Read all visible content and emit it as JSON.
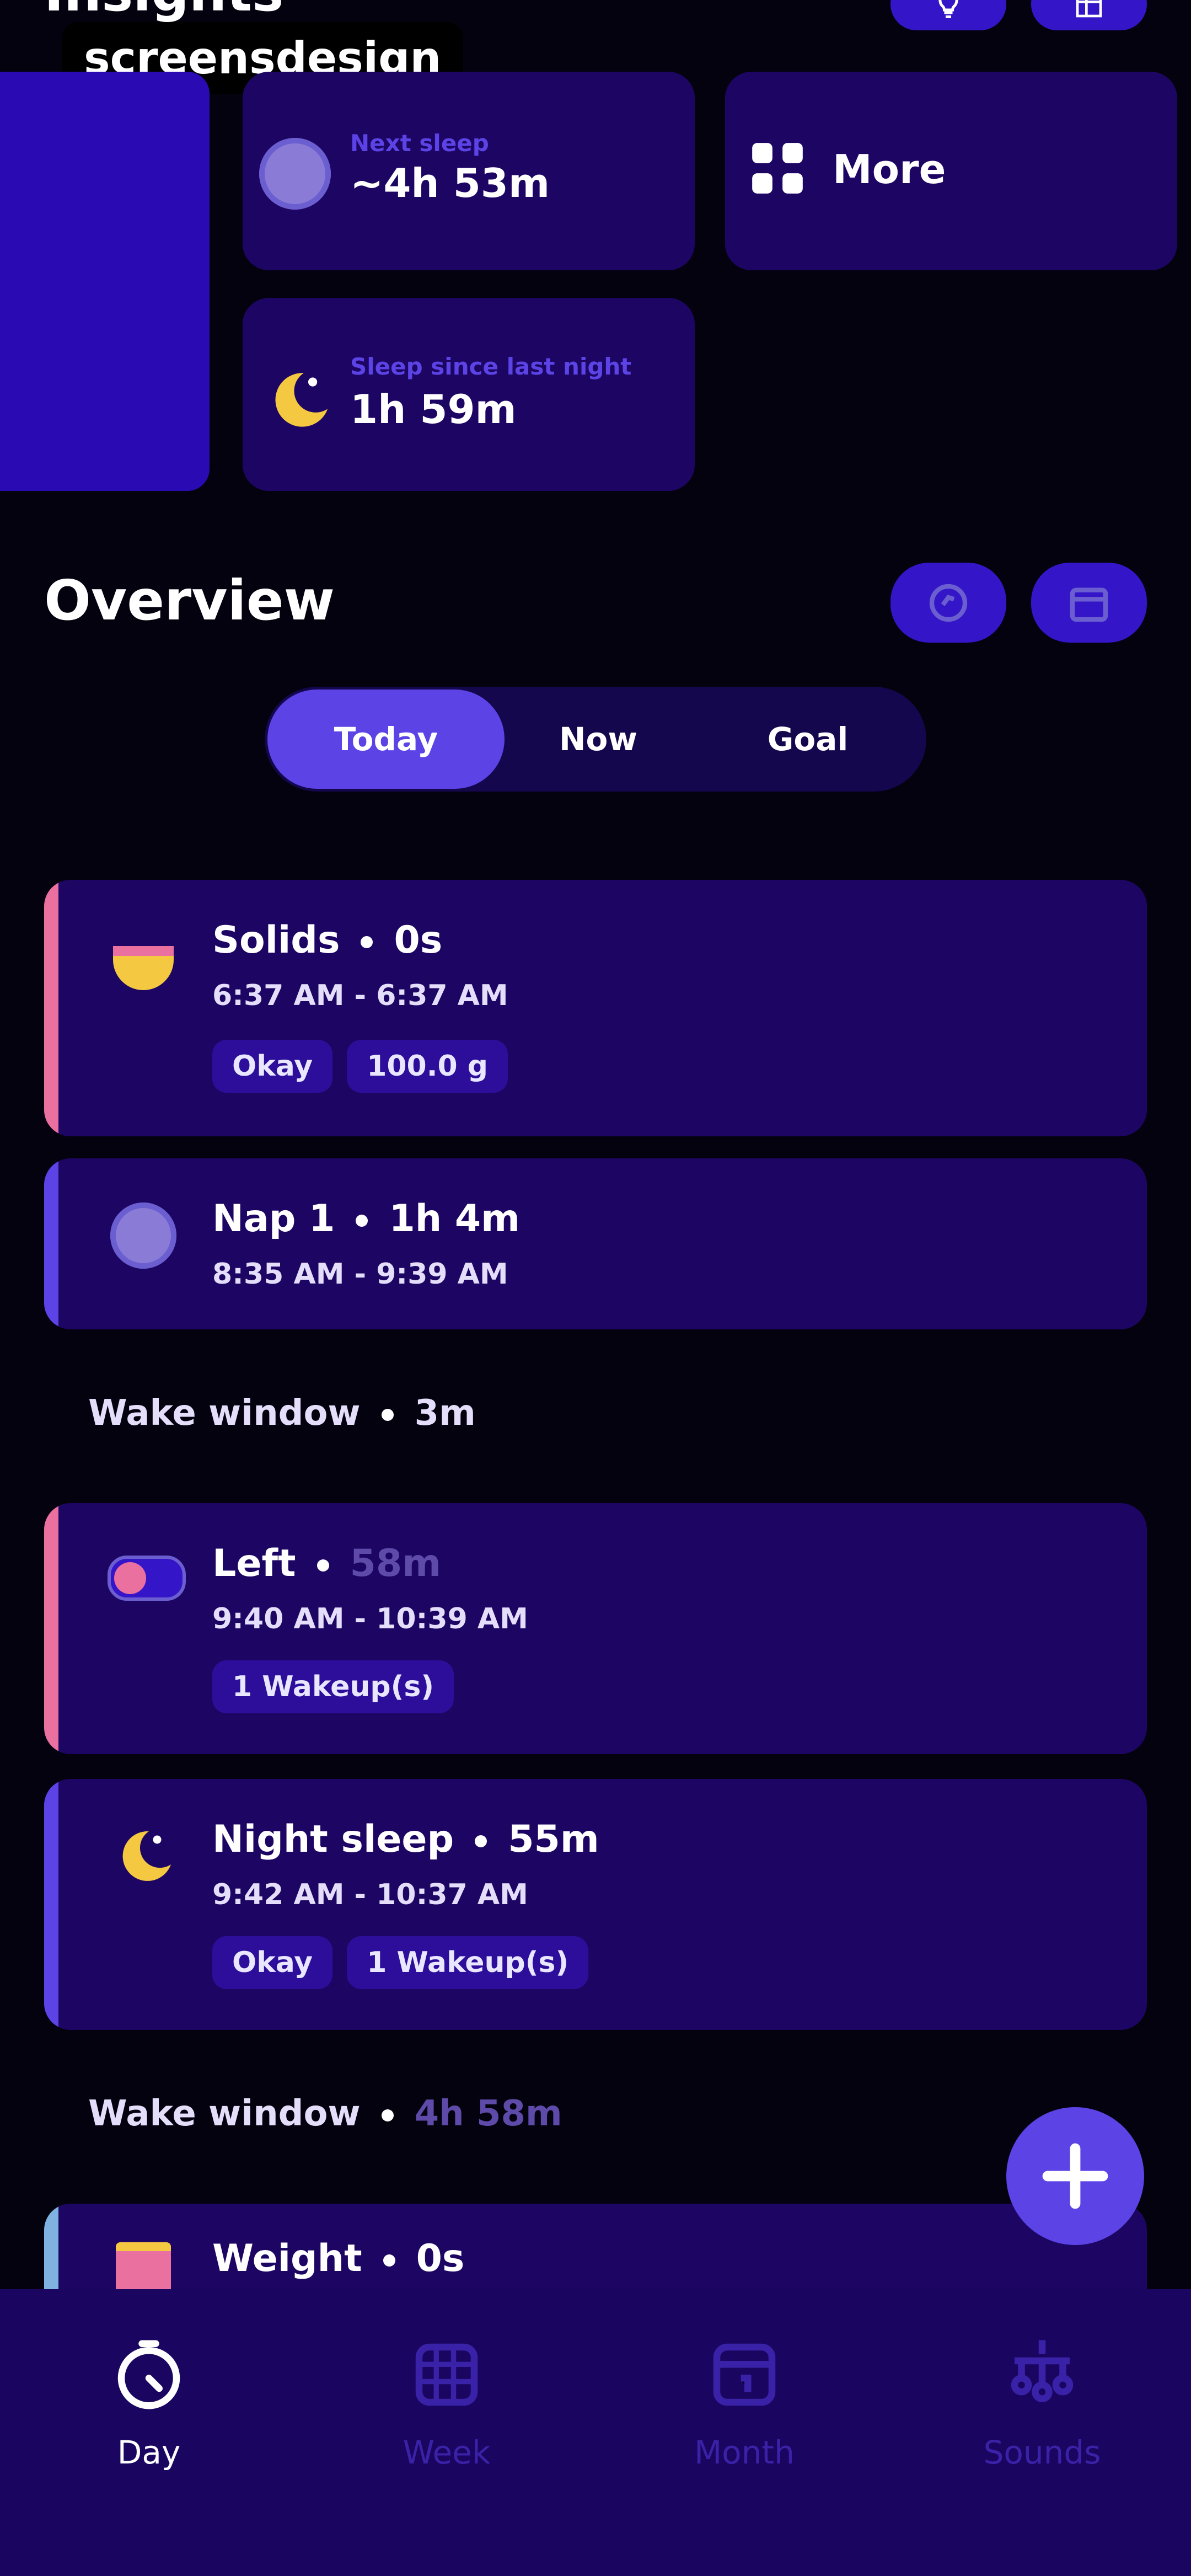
{
  "header": {
    "title": "Insights",
    "watermark": "screensdesign"
  },
  "insights": {
    "next_sleep_label": "Next sleep",
    "next_sleep_value": "~4h 53m",
    "more_label": "More",
    "sleep_since_label": "Sleep since last night",
    "sleep_since_value": "1h 59m"
  },
  "overview": {
    "title": "Overview",
    "tabs": [
      {
        "label": "Today"
      },
      {
        "label": "Now"
      },
      {
        "label": "Goal"
      }
    ]
  },
  "entries": [
    {
      "title": "Solids",
      "duration": "0s",
      "time": "6:37 AM - 6:37 AM",
      "tags": [
        "Okay",
        "100.0 g"
      ],
      "accent": "#e9709f"
    },
    {
      "title": "Nap 1",
      "duration": "1h 4m",
      "time": "8:35 AM - 9:39 AM",
      "tags": [],
      "accent": "#5b43e6"
    },
    {
      "title": "Left",
      "duration": "58m",
      "time": "9:40 AM - 10:39 AM",
      "tags": [
        "1 Wakeup(s)"
      ],
      "accent": "#e9709f"
    },
    {
      "title": "Night sleep",
      "duration": "55m",
      "time": "9:42 AM - 10:37 AM",
      "tags": [
        "Okay",
        "1 Wakeup(s)"
      ],
      "accent": "#5b43e6"
    },
    {
      "title": "Weight",
      "duration": "0s",
      "accent": "#7fb2e0"
    }
  ],
  "wake_windows": [
    {
      "label": "Wake window",
      "value": "3m"
    },
    {
      "label": "Wake window",
      "value": "4h 58m"
    }
  ],
  "nav": [
    {
      "label": "Day"
    },
    {
      "label": "Week"
    },
    {
      "label": "Month"
    },
    {
      "label": "Sounds"
    }
  ],
  "colors": {
    "background": "#04020f",
    "card": "#1d0663",
    "accent": "#5b43e6",
    "nav_bg": "#1a0660",
    "nav_active": "#ffffff",
    "nav_inactive": "#3a22a8"
  }
}
